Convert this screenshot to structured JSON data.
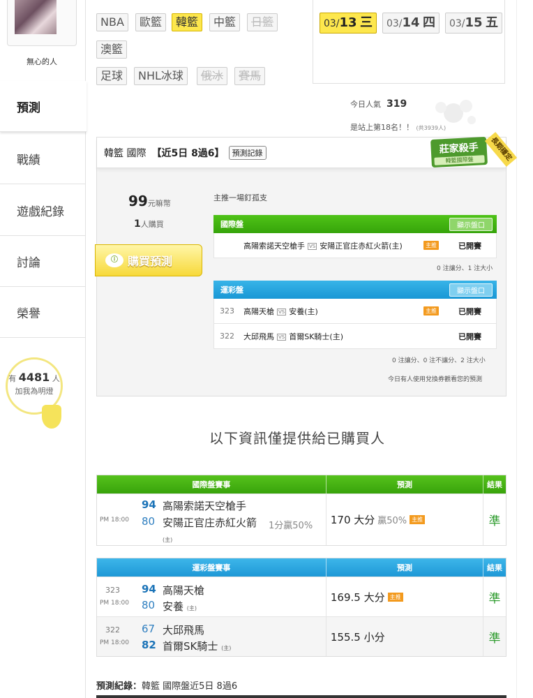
{
  "user": {
    "name": "無心的人"
  },
  "nav": [
    {
      "label": "預測",
      "active": true
    },
    {
      "label": "戰績"
    },
    {
      "label": "遊戲紀錄"
    },
    {
      "label": "討論"
    },
    {
      "label": "榮譽"
    }
  ],
  "fans": {
    "prefix": "有",
    "count": "4481",
    "suffix": "人",
    "caption": "加我為明燈"
  },
  "sport_tags": {
    "row1": [
      "NBA",
      "歐籃",
      "韓籃",
      "中籃",
      "日籃"
    ],
    "row2": [
      "澳籃"
    ],
    "row3": [
      "足球",
      "NHL冰球",
      "俄冰",
      "賽馬"
    ],
    "selected": "韓籃",
    "disabled": [
      "日籃",
      "俄冰",
      "賽馬"
    ]
  },
  "dates": [
    {
      "md": "03/",
      "d": "13",
      "w": "三",
      "selected": true
    },
    {
      "md": "03/",
      "d": "14",
      "w": "四"
    },
    {
      "md": "03/",
      "d": "15",
      "w": "五"
    }
  ],
  "popularity": {
    "label": "今日人氣",
    "value": "319",
    "rank_text": "是站上第18名！！",
    "rank_total": "(共3939人)"
  },
  "card": {
    "league": "韓籃 國際",
    "record": "【近5日 8過6】",
    "record_button": "預測記錄",
    "stamp_main": "莊家殺手",
    "stamp_sub": "韓籃國際盤",
    "stamp_ribbon": "長期穩定",
    "price": "99",
    "price_unit": "元嘛幣",
    "buyers": "1",
    "buyers_unit": "人購買",
    "buy_button": "購買預測",
    "buy_icon": "ⓘ",
    "hint": "主推一場釘孤支",
    "intl": {
      "title": "國際盤",
      "show_button": "顯示盤口",
      "rows": [
        {
          "no": "",
          "away": "高陽索諾天空槍手",
          "vs": "VS",
          "home": "安陽正官庄赤紅火箭(主)",
          "tag": "主推",
          "status": "已開賽"
        }
      ],
      "summary": "0 注讓分、1 注大小"
    },
    "lottery": {
      "title": "運彩盤",
      "show_button": "顯示盤口",
      "rows": [
        {
          "no": "323",
          "away": "高陽天槍",
          "vs": "VS",
          "home": "安養(主)",
          "tag": "主推",
          "status": "已開賽"
        },
        {
          "no": "322",
          "away": "大邱飛馬",
          "vs": "VS",
          "home": "首爾SK騎士(主)",
          "tag": "",
          "status": "已開賽"
        }
      ],
      "summary": "0 注讓分、0 注不讓分、2 注大小",
      "coupon_note": "今日有人使用兌換券觀看您的預測"
    }
  },
  "section_title": "以下資訊僅提供給已購買人",
  "intl_table": {
    "headers": [
      "國際盤賽事",
      "預測",
      "結果"
    ],
    "rows": [
      {
        "time": "PM 18:00",
        "score1": "94",
        "team1": "高陽索諾天空槍手",
        "score2": "80",
        "team2": "安陽正官庄赤紅火箭",
        "home_mark": "(主)",
        "handicap": "1分贏50%",
        "pick": "170 大分",
        "pick_extra": "贏50%",
        "tag": "主推",
        "result": "準"
      }
    ]
  },
  "lottery_table": {
    "headers": [
      "運彩盤賽事",
      "預測",
      "結果"
    ],
    "rows": [
      {
        "no": "323",
        "time": "PM 18:00",
        "score1": "94",
        "team1": "高陽天槍",
        "score2": "80",
        "team2": "安養",
        "home_mark": "(主)",
        "pick": "169.5 大分",
        "tag": "主推",
        "result": "準"
      },
      {
        "no": "322",
        "time": "PM 18:00",
        "score1": "67",
        "team1": "大邱飛馬",
        "score2": "82",
        "team2": "首爾SK騎士",
        "home_mark": "(主)",
        "pick": "155.5 小分",
        "tag": "",
        "result": "準"
      }
    ]
  },
  "record_footer": {
    "label": "預測紀錄：",
    "text": "韓籃 國際盤近5日 8過6"
  },
  "colors": {
    "accent_yellow": "#fde74d",
    "green": "#38a30b",
    "blue": "#1e98d6",
    "hit": "#2a9a2a"
  }
}
